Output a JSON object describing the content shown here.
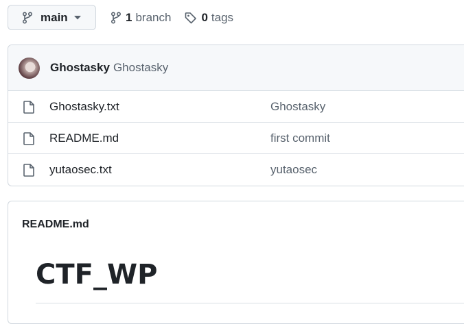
{
  "toolbar": {
    "branch_button_label": "main",
    "branches_count": "1",
    "branches_label": "branch",
    "tags_count": "0",
    "tags_label": "tags"
  },
  "commit": {
    "author": "Ghostasky",
    "message": "Ghostasky"
  },
  "files": [
    {
      "name": "Ghostasky.txt",
      "commit_message": "Ghostasky"
    },
    {
      "name": "README.md",
      "commit_message": "first commit"
    },
    {
      "name": "yutaosec.txt",
      "commit_message": "yutaosec"
    }
  ],
  "readme": {
    "header": "README.md",
    "title": "CTF_WP"
  },
  "icons": {
    "branch": "git-branch-icon",
    "tag": "tag-icon",
    "file": "file-icon",
    "caret": "chevron-down-icon"
  },
  "colors": {
    "text_primary": "#1f2328",
    "text_muted": "#59636e",
    "border": "#d0d7de",
    "header_bg": "#f6f8fa"
  }
}
